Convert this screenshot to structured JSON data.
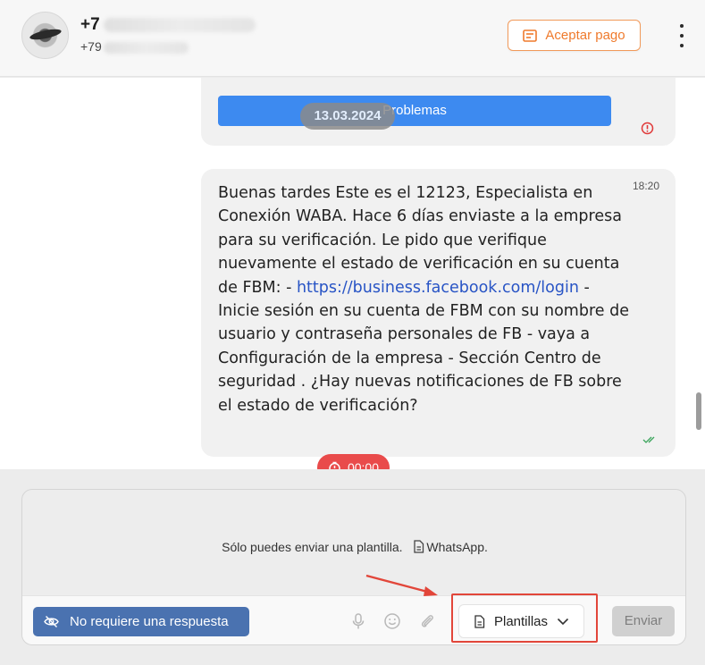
{
  "contact": {
    "name_visible": "+7",
    "phone_visible": "+79"
  },
  "header": {
    "accept_payment_label": "Aceptar pago"
  },
  "messages": {
    "date_separator": "13.03.2024",
    "first_button_label": "Problemas",
    "second": {
      "time": "18:20",
      "text_before_link": "Buenas tardes Este es el 12123, Especialista en Conexión WABA. Hace 6 días enviaste a la empresa para su verificación. Le pido que verifique nuevamente el estado de verificación en su cuenta de FBM: - ",
      "link": "https://business.facebook.com/login",
      "text_after_link": " - Inicie sesión en su cuenta de FBM con su nombre de usuario y contraseña personales de FB - vaya a Configuración de la empresa - Sección Centro de seguridad . ¿Hay nuevas notificaciones de FB sobre el estado de verificación?"
    },
    "timer": "00:00"
  },
  "composer": {
    "notice_text": "Sólo puedes enviar una plantilla.",
    "notice_channel": "WhatsApp.",
    "no_response_label": "No requiere una respuesta",
    "templates_label": "Plantillas",
    "send_label": "Enviar"
  },
  "colors": {
    "accent_orange": "#ef7a2c",
    "primary_blue": "#3d8af0",
    "no_response_blue": "#4a72b0",
    "timer_red": "#e94b4b",
    "annotation_red": "#e2463a"
  },
  "icons": [
    "document-icon",
    "more-vertical-icon",
    "error-icon",
    "double-check-icon",
    "timer-icon",
    "eye-off-icon",
    "microphone-icon",
    "smile-icon",
    "paperclip-icon",
    "chevron-down-icon"
  ]
}
